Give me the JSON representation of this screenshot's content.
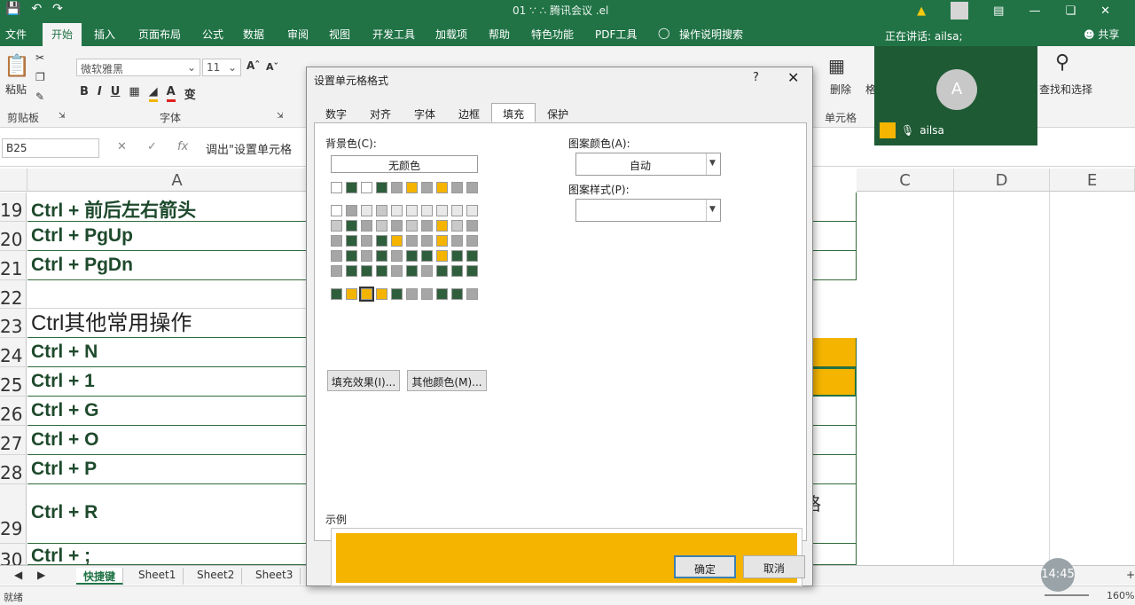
{
  "titlebar": {
    "title": "01 ∵ ∴ 腾讯会议 .el",
    "save_icon": "save-icon",
    "undo_icon": "undo-icon",
    "redo_icon": "redo-icon"
  },
  "ribbon_tabs": [
    "文件",
    "开始",
    "插入",
    "页面布局",
    "公式",
    "数据",
    "审阅",
    "视图",
    "开发工具",
    "加载项",
    "帮助",
    "特色功能",
    "PDF工具",
    "操作说明搜索"
  ],
  "ribbon_active_tab": "开始",
  "speaker": "正在讲话: ailsa;",
  "share": "共享",
  "ribbon": {
    "paste": "粘贴",
    "clipboard": "剪贴板",
    "font_name": "微软雅黑",
    "font_size": "11",
    "font_group": "字体",
    "delete": "删除",
    "cells_group": "单元格",
    "find_select": "查找和选择",
    "format_short": "格"
  },
  "namebox": "B25",
  "formula": "调出\"设置单元格",
  "columns": [
    "A",
    "C",
    "D",
    "E"
  ],
  "rows": [
    {
      "num": "19",
      "text": "Ctrl + 前后左右箭头"
    },
    {
      "num": "20",
      "text": "Ctrl + PgUp"
    },
    {
      "num": "21",
      "text": "Ctrl + PgDn"
    },
    {
      "num": "22",
      "text": ""
    },
    {
      "num": "23",
      "text": "Ctrl其他常用操作"
    },
    {
      "num": "24",
      "text": "Ctrl + N"
    },
    {
      "num": "25",
      "text": "Ctrl + 1"
    },
    {
      "num": "26",
      "text": "Ctrl + G"
    },
    {
      "num": "27",
      "text": "Ctrl + O"
    },
    {
      "num": "28",
      "text": "Ctrl + P"
    },
    {
      "num": "29",
      "text": "Ctrl + R"
    },
    {
      "num": "30",
      "text": "Ctrl + ;"
    }
  ],
  "colB_partial_text": "格",
  "sheets": [
    "快捷键",
    "Sheet1",
    "Sheet2",
    "Sheet3"
  ],
  "active_sheet": "快捷键",
  "status": {
    "ready": "就绪",
    "zoom": "160%",
    "clock": "14:45"
  },
  "meeting": {
    "avatar_letter": "A",
    "user": "ailsa"
  },
  "dialog": {
    "title": "设置单元格格式",
    "help": "?",
    "close": "✕",
    "tabs": [
      "数字",
      "对齐",
      "字体",
      "边框",
      "填充",
      "保护"
    ],
    "active_tab": "填充",
    "bg_label": "背景色(C):",
    "no_color": "无颜色",
    "fill_effects": "填充效果(I)...",
    "more_colors": "其他颜色(M)...",
    "pattern_color_label": "图案颜色(A):",
    "pattern_color_value": "自动",
    "pattern_style_label": "图案样式(P):",
    "sample_label": "示例",
    "ok": "确定",
    "cancel": "取消",
    "sample_color": "#f4b400"
  },
  "colors": {
    "excel_green": "#217346",
    "dark_green": "#2e5e3c",
    "amber": "#f4b400",
    "gray": "#a6a6a6",
    "light": "#e8e8e8"
  }
}
